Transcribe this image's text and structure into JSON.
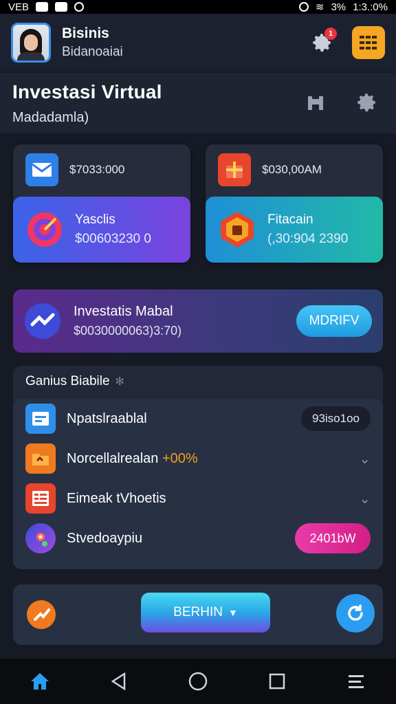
{
  "status_bar": {
    "left_text": "VEB",
    "right_text": "1:3.:0%",
    "signal": "3%"
  },
  "profile": {
    "name": "Bisinis",
    "subtitle": "Bidanoaiai"
  },
  "header": {
    "title": "Investasi Virtual",
    "subtitle": "Madadamla)"
  },
  "wallets": [
    {
      "amount": "$7033:000",
      "sub_title": "Yasclis",
      "sub_value": "$00603230 0",
      "icon": "envelope-icon",
      "sub_icon": "target-icon"
    },
    {
      "amount": "$030,00AM",
      "sub_title": "Fitacain",
      "sub_value": "(,30:904 2390",
      "icon": "gift-box-icon",
      "sub_icon": "shield-icon"
    }
  ],
  "investment": {
    "title": "Investatis Mabal",
    "value": "$0030000063)3:70)",
    "button": "MDRIFV"
  },
  "list": {
    "header": "Ganius Biabile",
    "rows": [
      {
        "label": "Npatslraablal",
        "highlight": "",
        "right": "93iso1oo",
        "type": "pill-dark"
      },
      {
        "label": "Norcellalrealan",
        "highlight": "+00%",
        "right": "",
        "type": "chevron"
      },
      {
        "label": "Eimeak tVhoetis",
        "highlight": "",
        "right": "",
        "type": "chevron"
      },
      {
        "label": "Stvedoaypiu",
        "highlight": "",
        "right": "2401bW",
        "type": "pill-pink"
      }
    ]
  },
  "actions": {
    "primary": "BERHIN"
  },
  "colors": {
    "accent": "#2a9df0",
    "orange": "#f5a623",
    "pink": "#d31f86"
  }
}
